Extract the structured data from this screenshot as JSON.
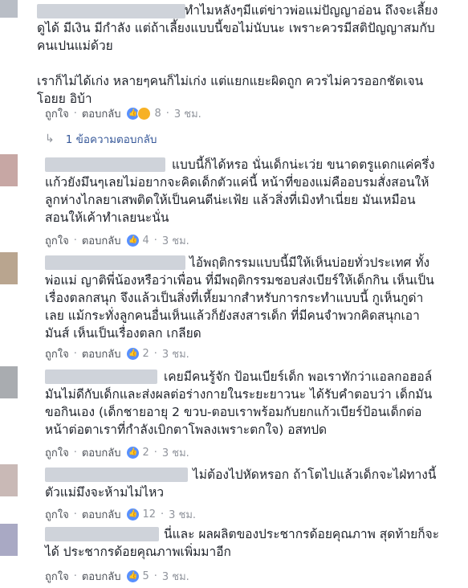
{
  "comments": [
    {
      "text_lines": "ทำไมหลังๆมีแต่ข่าวพ่อแม่ปัญญาอ่อน ถึงจะเลี้ยง\nดูได้ มีเงิน มีกำลัง แต่ถ้าเลี้ยงแบบนี้ขอไม่นับนะ เพราะควรมีสติปัญญาสมกับ\nคนเปนแม่ด้วย\n\nเราก็ไม่ได้เก่ง หลายๆคนก็ไม่เก่ง แต่แยกแยะผิดถูก ควรไม่ควรออกชัดเจน\nโอยย อิบ้า",
      "like": "ถูกใจ",
      "reply": "ตอบกลับ",
      "count": "8",
      "time": "3 ชม.",
      "replies_label": "1 ข้อความตอบกลับ"
    },
    {
      "text_lines": "แบบนี้ก็ได้หรอ นั่นเด็กน่ะเว่ย ขนาดตรูแดกแค่ครึ่ง\nแก้วยังมึนๆเลยไม่อยากจะคิดเด็กตัวแค่นี้ หน้าที่ของแม่คืออบรมสั่งสอนให้\nลูกห่างไกลยาเสพติดให้เป็นคนดีน่ะเฟ้ย แล้วสิ่งที่เมิงทำเนี่ยย มันเหมือน\nสอนให้เค้าทำเลยนะนั่น",
      "like": "ถูกใจ",
      "reply": "ตอบกลับ",
      "count": "4",
      "time": "3 ชม."
    },
    {
      "text_lines": "ไอ้พฤติกรรมแบบนี้มีให้เห็นบ่อยทั่วประเทศ ทั้ง\nพ่อแม่ ญาติพี่น้องหรือว่าเพื่อน ที่มีพฤติกรรมชอบส่งเบียร์ให้เด็กกิน เห็นเป็น\nเรื่องตลกสนุก จึงแล้วเป็นสิ่งที่เหี้ยมากสำหรับการกระทำแบบนี้ กูเห็นกูด่า\nเลย แม้กระทั่งลูกคนอื่นเห็นแล้วก็ยังสงสารเด็ก ที่มีคนจำพวกคิดสนุกเอา\nมันส์ เห็นเป็นเรื่องตลก เกลียด",
      "like": "ถูกใจ",
      "reply": "ตอบกลับ",
      "count": "2",
      "time": "3 ชม."
    },
    {
      "text_lines": "เคยมีคนรู้จัก ป้อนเบียร์เด็ก พอเราทักว่าแอลกอฮอล์\nมันไม่ดีกับเด็กและส่งผลต่อร่างกายในระยะยาวนะ ได้รับคำตอบว่า เด็กมัน\nขอกินเอง (เด็กชายอายุ 2 ขวบ-ตอบเราพร้อมกับยกแก้วเบียร์ป้อนเด็กต่อ\nหน้าต่อตาเราที่กำลังเบิกตาโพลงเพราะตกใจ) อสทปด",
      "like": "ถูกใจ",
      "reply": "ตอบกลับ",
      "count": "2",
      "time": "3 ชม."
    },
    {
      "text_lines": "ไม่ต้องไปหัดหรอก ถ้าโตไปแล้วเด็กจะไฝ่ทางนี้\nตัวแม่มึงจะห้ามไม่ไหว",
      "like": "ถูกใจ",
      "reply": "ตอบกลับ",
      "count": "12",
      "time": "3 ชม."
    },
    {
      "text_lines": "นี่และ ผลผลิตของประชากรด้อยคุณภาพ สุดท้ายก็จะ\nได้ ประชากรด้อยคุณภาพเพิ่มมาอีก",
      "like": "ถูกใจ",
      "reply": "ตอบกลับ",
      "count": "5",
      "time": "3 ชม."
    }
  ]
}
